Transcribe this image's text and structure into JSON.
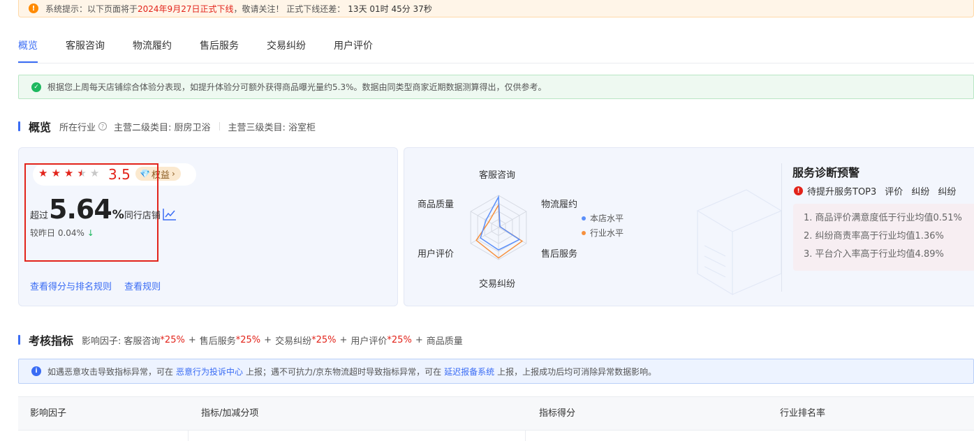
{
  "notice": {
    "icon": "warning-icon",
    "prefix": "系统提示：以下页面将于",
    "date": "2024年9月27日正式下线",
    "mid": "，敬请关注！ 正式下线还差：",
    "countdown": "13天 01时 45分 37秒"
  },
  "tabs": [
    "概览",
    "客服咨询",
    "物流履约",
    "售后服务",
    "交易纠纷",
    "用户评价"
  ],
  "active_tab": "概览",
  "green_tip": "根据您上周每天店铺综合体验分表现，如提升体验分可额外获得商品曝光量约5.3%。数据由同类型商家近期数据测算得出，仅供参考。",
  "overview": {
    "title": "概览",
    "industry_label": "所在行业",
    "category2": "主营二级类目: 厨房卫浴",
    "category3": "主营三级类目: 浴室柜"
  },
  "score_card": {
    "rating": "3.5",
    "stars": [
      "full",
      "full",
      "full",
      "half",
      "empty"
    ],
    "benefit_label": "权益",
    "exceed_prefix": "超过",
    "exceed_value": "5.64",
    "exceed_unit": "%",
    "exceed_suffix": "同行店铺",
    "compare_label": "较昨日 0.04%",
    "compare_arrow": "↓",
    "link_rules": "查看得分与排名规则",
    "link_view": "查看规则"
  },
  "radar": {
    "labels": [
      "客服咨询",
      "物流履约",
      "售后服务",
      "交易纠纷",
      "用户评价",
      "商品质量"
    ],
    "legend": [
      {
        "name": "本店水平",
        "color": "#5b8ff9"
      },
      {
        "name": "行业水平",
        "color": "#f6903d"
      }
    ],
    "store_values": [
      0.95,
      0.05,
      0.75,
      0.7,
      0.65,
      0.45
    ],
    "industry_values": [
      0.7,
      0.05,
      0.85,
      0.95,
      0.8,
      0.35
    ]
  },
  "diagnosis": {
    "title": "服务诊断预警",
    "sub_label": "待提升服务TOP3",
    "tags": [
      "评价",
      "纠纷",
      "纠纷"
    ],
    "items": [
      "1. 商品评价满意度低于行业均值0.51%",
      "2. 纠纷商责率高于行业均值1.36%",
      "3. 平台介入率高于行业均值4.89%"
    ]
  },
  "assessment": {
    "title": "考核指标",
    "factor_label": "影响因子:",
    "factors": [
      {
        "name": "客服咨询",
        "weight": "*25%"
      },
      {
        "name": "售后服务",
        "weight": "*25%"
      },
      {
        "name": "交易纠纷",
        "weight": "*25%"
      },
      {
        "name": "用户评价",
        "weight": "*25%"
      },
      {
        "name": "商品质量",
        "weight": ""
      }
    ],
    "plus": "+"
  },
  "blue_tip": {
    "part1": "如遇恶意攻击导致指标异常，可在",
    "link1": "恶意行为投诉中心",
    "part2": "上报；遇不可抗力/京东物流超时导致指标异常，可在",
    "link2": "延迟报备系统",
    "part3": "上报，上报成功后均可消除异常数据影响。"
  },
  "table": {
    "headers": [
      "影响因子",
      "指标/加减分项",
      "指标得分",
      "行业排名率"
    ]
  },
  "colors": {
    "accent": "#3a6cf4",
    "red": "#e2231a",
    "green": "#1eb85f",
    "orange": "#ff8a00"
  }
}
